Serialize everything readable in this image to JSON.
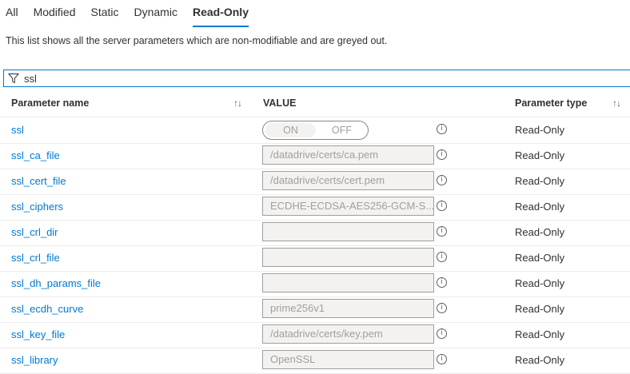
{
  "tabs": [
    {
      "label": "All",
      "active": false
    },
    {
      "label": "Modified",
      "active": false
    },
    {
      "label": "Static",
      "active": false
    },
    {
      "label": "Dynamic",
      "active": false
    },
    {
      "label": "Read-Only",
      "active": true
    }
  ],
  "description": "This list shows all the server parameters which are non-modifiable and are greyed out.",
  "filter": {
    "value": "ssl",
    "icon": "filter-icon"
  },
  "columns": {
    "name": "Parameter name",
    "value": "VALUE",
    "type": "Parameter type",
    "sort_glyph": "↑↓"
  },
  "toggle": {
    "on_label": "ON",
    "off_label": "OFF"
  },
  "info_glyph": "i",
  "rows": [
    {
      "name": "ssl",
      "kind": "toggle",
      "value": "",
      "type": "Read-Only"
    },
    {
      "name": "ssl_ca_file",
      "kind": "text",
      "value": "/datadrive/certs/ca.pem",
      "type": "Read-Only"
    },
    {
      "name": "ssl_cert_file",
      "kind": "text",
      "value": "/datadrive/certs/cert.pem",
      "type": "Read-Only"
    },
    {
      "name": "ssl_ciphers",
      "kind": "text",
      "value": "ECDHE-ECDSA-AES256-GCM-S...",
      "type": "Read-Only"
    },
    {
      "name": "ssl_crl_dir",
      "kind": "text",
      "value": "",
      "type": "Read-Only"
    },
    {
      "name": "ssl_crl_file",
      "kind": "text",
      "value": "",
      "type": "Read-Only"
    },
    {
      "name": "ssl_dh_params_file",
      "kind": "text",
      "value": "",
      "type": "Read-Only"
    },
    {
      "name": "ssl_ecdh_curve",
      "kind": "text",
      "value": "prime256v1",
      "type": "Read-Only"
    },
    {
      "name": "ssl_key_file",
      "kind": "text",
      "value": "/datadrive/certs/key.pem",
      "type": "Read-Only"
    },
    {
      "name": "ssl_library",
      "kind": "text",
      "value": "OpenSSL",
      "type": "Read-Only"
    }
  ],
  "colors": {
    "accent": "#0078d4",
    "text": "#323130",
    "disabled": "#a19f9d",
    "disabled_bg": "#f3f2f1"
  }
}
